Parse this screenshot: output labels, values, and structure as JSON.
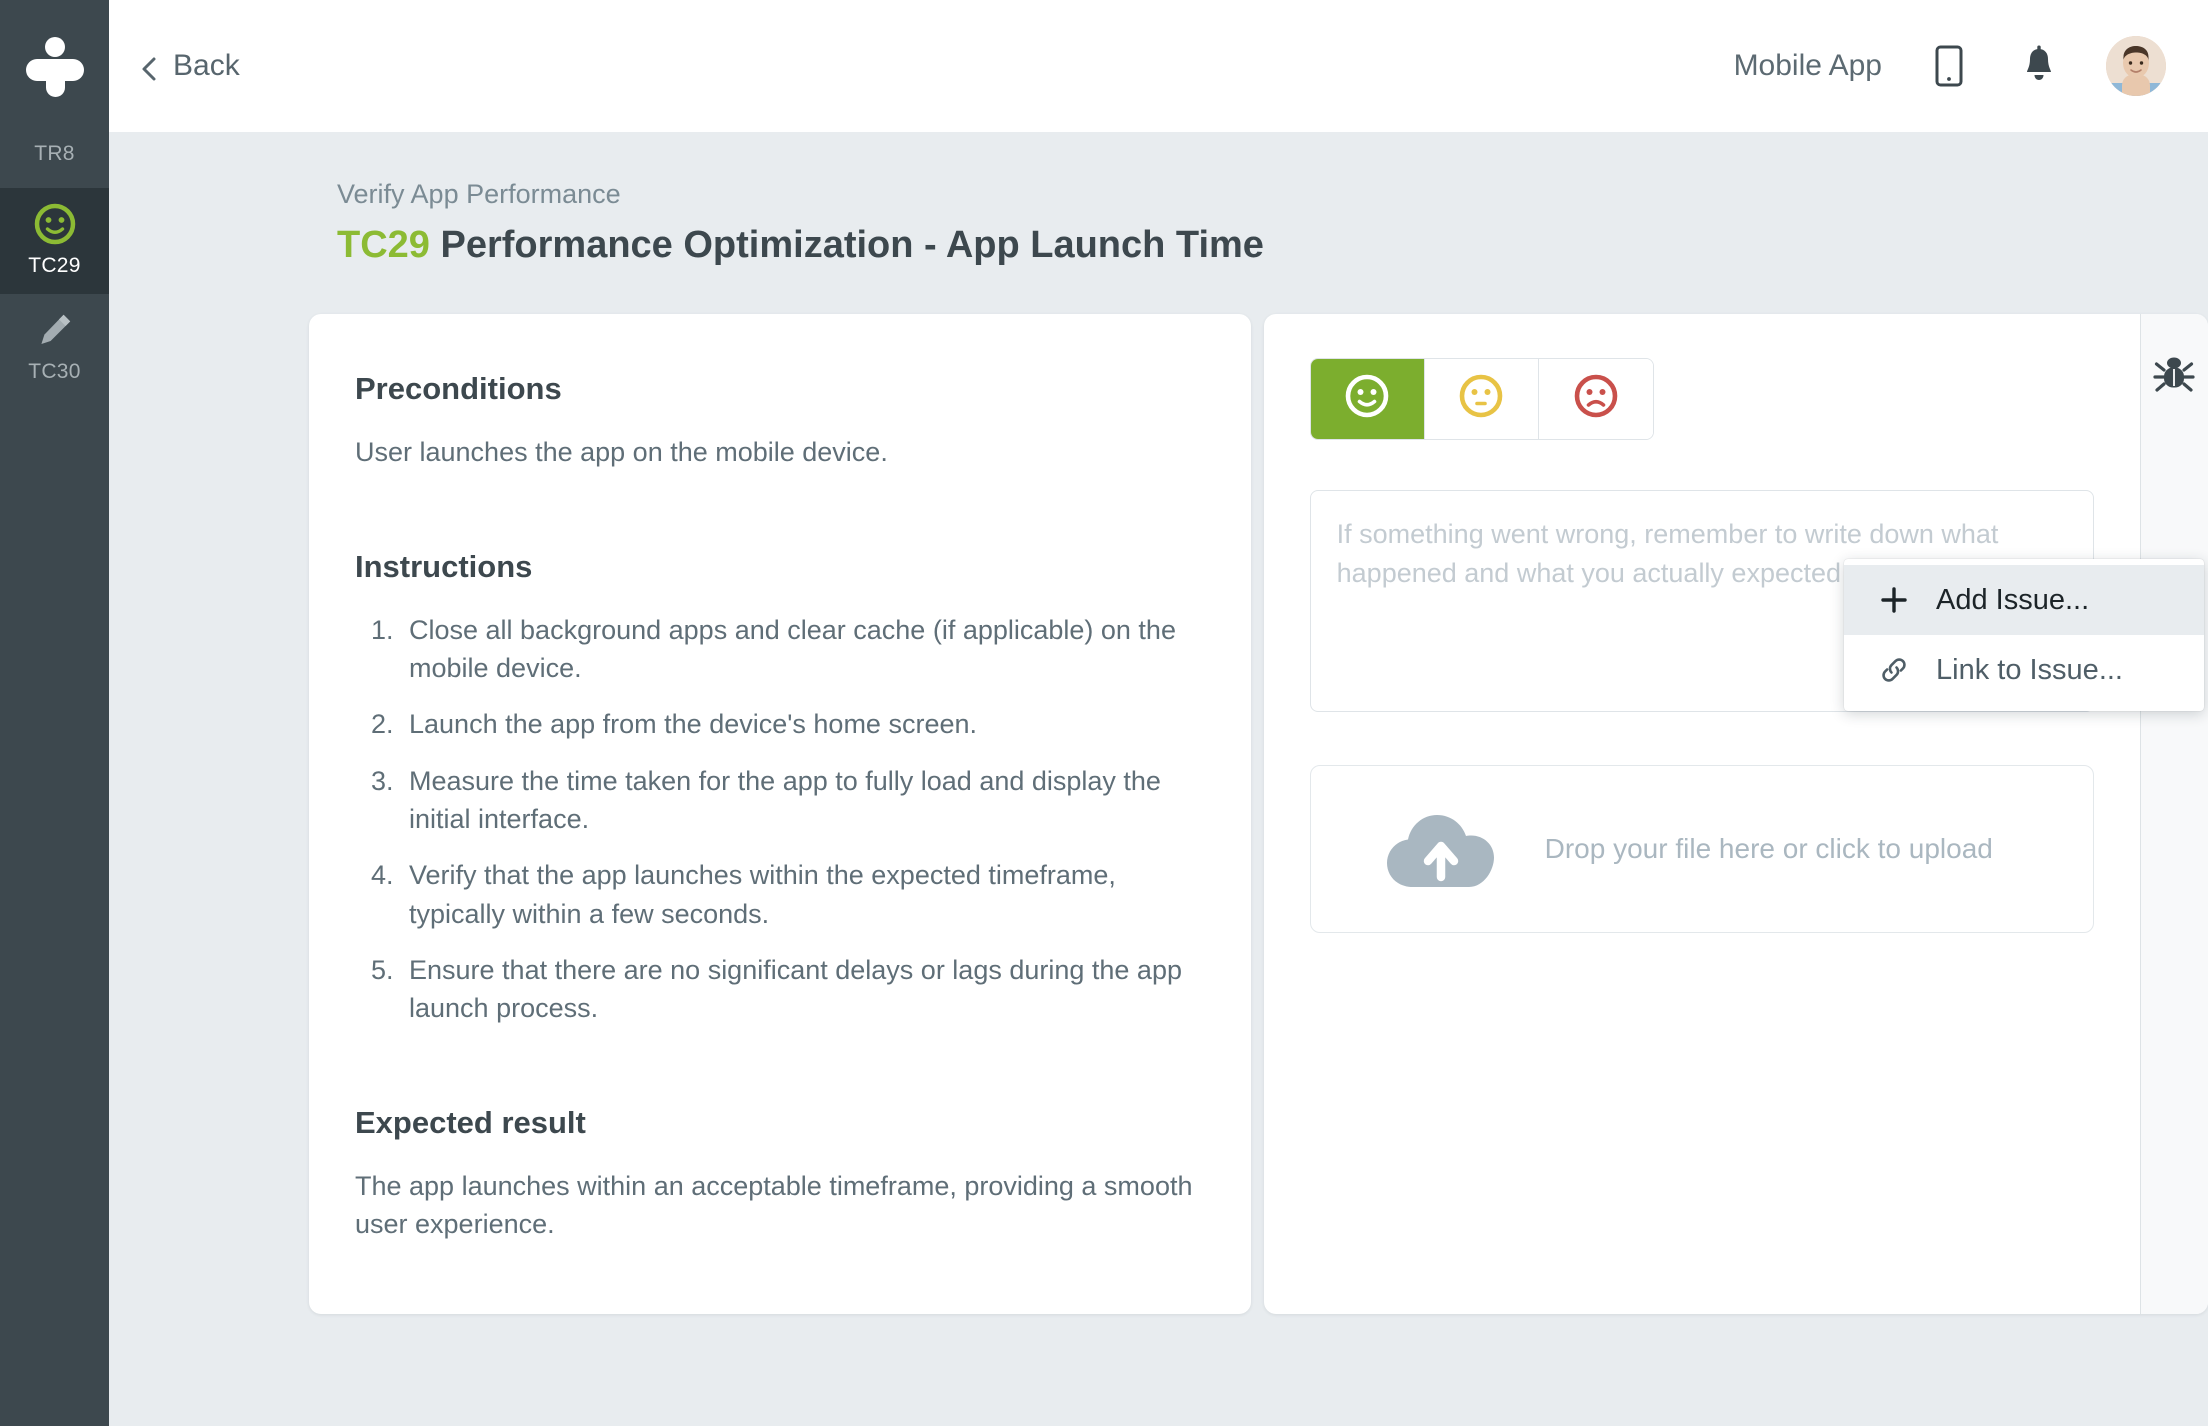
{
  "sidebar": {
    "logo_name": "testmo-logo",
    "items": [
      {
        "label": "TR8",
        "icon": "none",
        "active": false
      },
      {
        "label": "TC29",
        "icon": "smiley-icon",
        "active": true
      },
      {
        "label": "TC30",
        "icon": "pencil-icon",
        "active": false
      }
    ]
  },
  "topbar": {
    "back_label": "Back",
    "project_name": "Mobile App",
    "device_icon": "mobile-device-icon",
    "notification_icon": "bell-icon",
    "avatar_name": "user-avatar"
  },
  "page": {
    "breadcrumb": "Verify App Performance",
    "case_id": "TC29",
    "title": "Performance Optimization - App Launch Time",
    "case_id_color": "#8cbb34"
  },
  "left_card": {
    "preconditions_heading": "Preconditions",
    "preconditions_text": "User launches the app on the mobile device.",
    "instructions_heading": "Instructions",
    "instructions": [
      "Close all background apps and clear cache (if applicable) on the mobile device.",
      "Launch the app from the device's home screen.",
      "Measure the time taken for the app to fully load and display the initial interface.",
      "Verify that the app launches within the expected timeframe, typically within a few seconds.",
      "Ensure that there are no significant delays or lags during the app launch process."
    ],
    "expected_heading": "Expected result",
    "expected_text": "The app launches within an acceptable timeframe, providing a smooth user experience."
  },
  "right_card": {
    "statuses": [
      {
        "name": "passed",
        "icon": "smiley-happy-icon",
        "selected": true,
        "color": "#7cae2e"
      },
      {
        "name": "blocked",
        "icon": "smiley-neutral-icon",
        "selected": false,
        "color": "#e8c345"
      },
      {
        "name": "failed",
        "icon": "smiley-sad-icon",
        "selected": false,
        "color": "#c9504b"
      }
    ],
    "comment_placeholder": "If something went wrong, remember to write down what happened and what you actually expected to happen.",
    "comment_value": "",
    "upload_text": "Drop your file here or click to upload",
    "upload_icon": "cloud-upload-icon",
    "bug_icon": "bug-icon"
  },
  "issue_menu": {
    "items": [
      {
        "label": "Add Issue...",
        "icon": "plus-icon",
        "hovered": true
      },
      {
        "label": "Link to Issue...",
        "icon": "link-icon",
        "hovered": false
      }
    ]
  }
}
